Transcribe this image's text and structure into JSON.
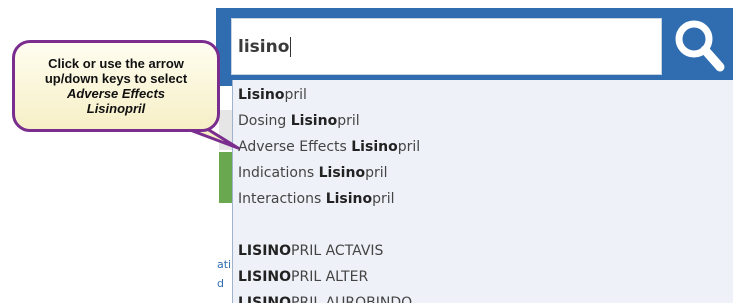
{
  "search": {
    "query": "lisino"
  },
  "callout": {
    "line1": "Click or use the arrow",
    "line2": "up/down keys to select",
    "line3": "Adverse Effects",
    "line4": "Lisinopril"
  },
  "suggestions": [
    {
      "prefix": "",
      "match": "Lisino",
      "suffix": "pril"
    },
    {
      "prefix": "Dosing ",
      "match": "Lisino",
      "suffix": "pril"
    },
    {
      "prefix": "Adverse Effects ",
      "match": "Lisino",
      "suffix": "pril"
    },
    {
      "prefix": "Indications ",
      "match": "Lisino",
      "suffix": "pril"
    },
    {
      "prefix": "Interactions ",
      "match": "Lisino",
      "suffix": "pril"
    },
    {
      "prefix": "",
      "match": "LISINO",
      "suffix": "PRIL ACTAVIS"
    },
    {
      "prefix": "",
      "match": "LISINO",
      "suffix": "PRIL ALTER"
    },
    {
      "prefix": "",
      "match": "LISINO",
      "suffix": "PRIL AUROBINDO"
    }
  ],
  "left_fragments": [
    "ati",
    "d"
  ],
  "colors": {
    "search_bar": "#2f6db0",
    "callout_border": "#7a2d8e",
    "callout_fill": "#f6efc6",
    "dropdown_bg": "#eef2f8"
  },
  "icons": {
    "search": "magnifier-icon"
  }
}
